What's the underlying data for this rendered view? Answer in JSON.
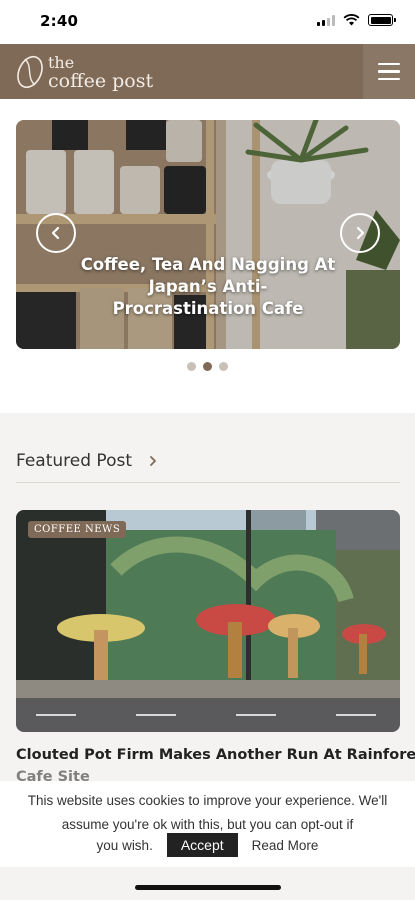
{
  "status_bar": {
    "time": "2:40"
  },
  "header": {
    "logo_the": "the",
    "logo_name": "coffee post"
  },
  "carousel": {
    "title_line1": "Coffee, Tea And Nagging At",
    "title_line2": "Japan’s Anti-",
    "title_line3": "Procrastination Cafe",
    "slide_count": 3,
    "active_slide": 2
  },
  "featured": {
    "heading": "Featured Post",
    "post": {
      "category": "COFFEE NEWS",
      "title": "Clouted Pot Firm Makes Another Run At Rainforest",
      "title_cont": "Cafe Site"
    }
  },
  "cookie_banner": {
    "text": "This website uses cookies to improve your experience. We'll assume you're ok with this, but you can opt-out if",
    "lead": "you wish.",
    "accept_label": "Accept",
    "read_more_label": "Read More"
  },
  "colors": {
    "brand": "#7f6a58",
    "section_bg": "#f4f3f1"
  }
}
